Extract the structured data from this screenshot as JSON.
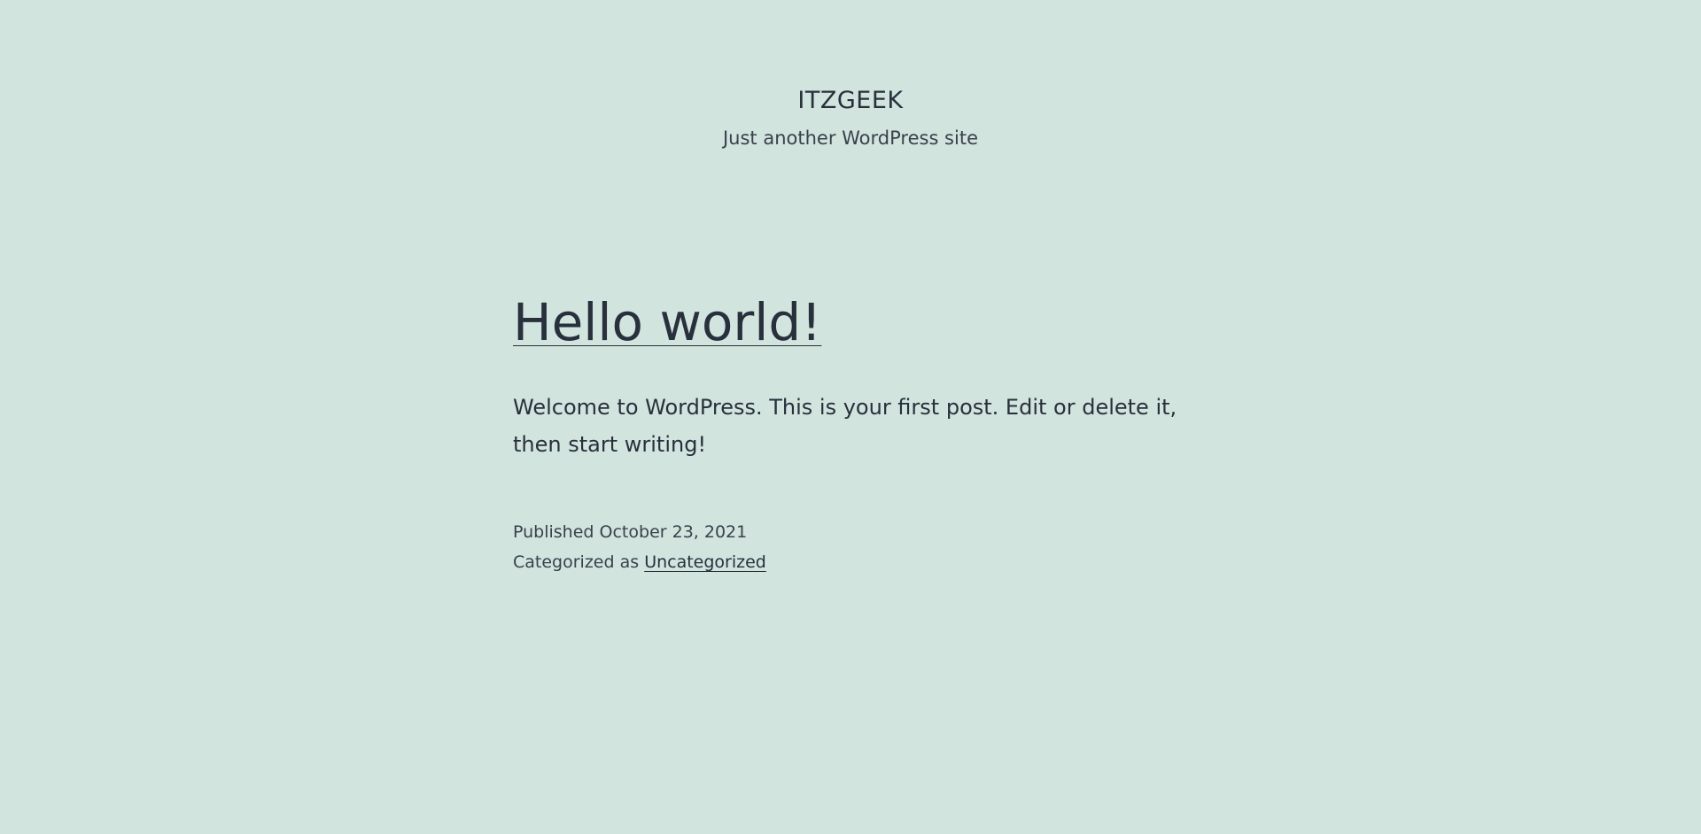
{
  "site": {
    "title": "ITZGEEK",
    "tagline": "Just another WordPress site"
  },
  "post": {
    "title": "Hello world!",
    "content": "Welcome to WordPress. This is your first post. Edit or delete it, then start writing!",
    "meta": {
      "published_label": "Published",
      "published_date": "October 23, 2021",
      "category_label": "Categorized as",
      "category": "Uncategorized"
    }
  },
  "colors": {
    "background": "#d1e4dd",
    "text": "#28303d"
  }
}
